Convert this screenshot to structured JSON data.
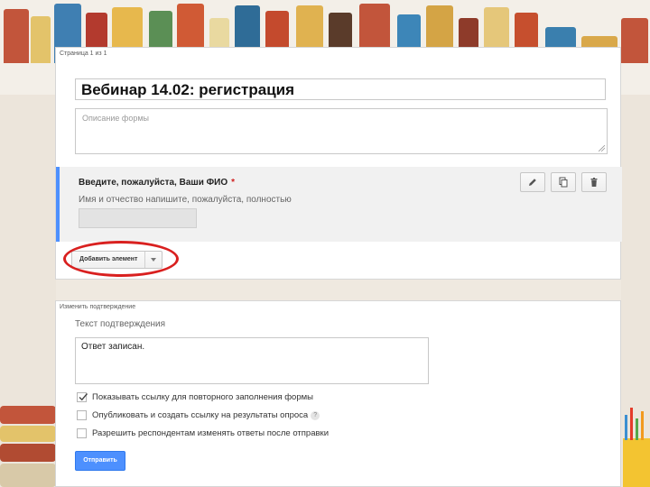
{
  "pages": {
    "main": {
      "caption": "Страница 1 из 1",
      "form_title": "Вебинар  14.02: регистрация",
      "description_placeholder": "Описание формы"
    },
    "confirmation": {
      "caption": "Изменить подтверждение"
    }
  },
  "question": {
    "title": "Введите, пожалуйста, Ваши ФИО",
    "required_mark": "*",
    "help_text": "Имя и отчество напишите, пожалуйста, полностью",
    "tools": [
      "pencil-icon",
      "copy-icon",
      "trash-icon"
    ]
  },
  "add_item": {
    "label": "Добавить элемент"
  },
  "confirmation": {
    "heading": "Текст подтверждения",
    "message": "Ответ записан.",
    "options": [
      {
        "label": "Показывать ссылку для повторного заполнения формы",
        "checked": true
      },
      {
        "label": "Опубликовать и создать ссылку на результаты опроса",
        "checked": false,
        "help_icon": "?"
      },
      {
        "label": "Разрешить респондентам изменять ответы после отправки",
        "checked": false
      }
    ],
    "submit_label": "Отправить"
  },
  "colors": {
    "accent": "#4d90fe",
    "highlight_oval": "#d9201f"
  }
}
